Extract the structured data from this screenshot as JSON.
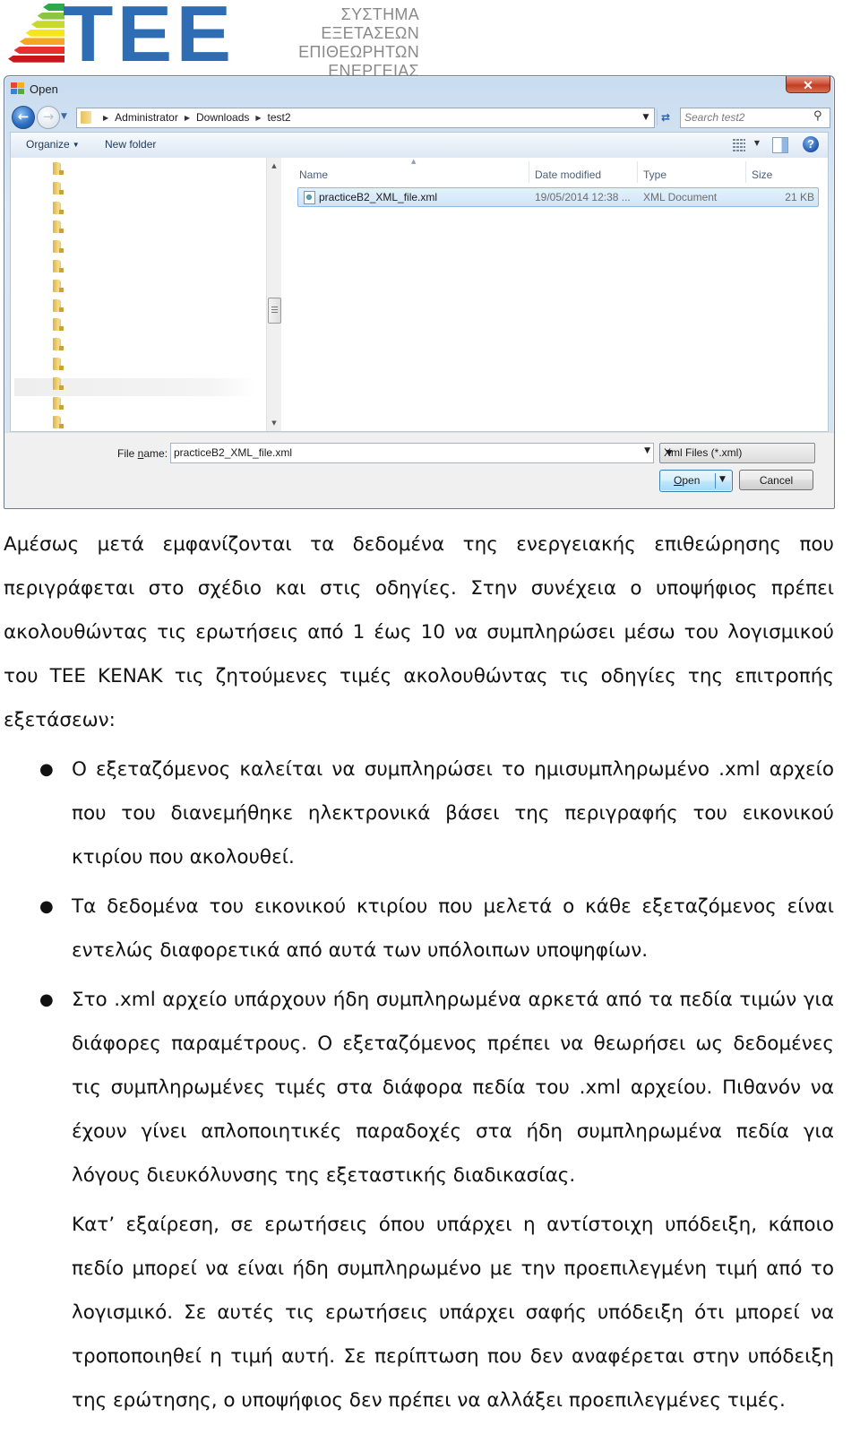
{
  "header": {
    "logo_text": "TEE",
    "system_title_lines": [
      "ΣΥΣΤΗΜΑ ΕΞΕΤΑΣΕΩΝ",
      "ΕΠΙΘΕΩΡΗΤΩΝ",
      "ΕΝΕΡΓΕΙΑΣ"
    ],
    "energy_bar_colors": [
      "#2ea84a",
      "#8cc63f",
      "#c7d92b",
      "#f5e61c",
      "#f5a623",
      "#e8312f",
      "#c8161d"
    ],
    "brand_color": "#2e6db4"
  },
  "dialog": {
    "title": "Open",
    "close_label": "✕",
    "address": {
      "breadcrumbs": [
        "Administrator",
        "Downloads",
        "test2"
      ]
    },
    "search": {
      "placeholder": "Search test2"
    },
    "toolbar": {
      "organize_label": "Organize",
      "new_folder_label": "New folder",
      "help_label": "?"
    },
    "nav_pane": {
      "folder_count": 14,
      "selected_index": 11
    },
    "file_list": {
      "columns": [
        "Name",
        "Date modified",
        "Type",
        "Size"
      ],
      "rows": [
        {
          "name": "practiceB2_XML_file.xml",
          "date_modified": "19/05/2014 12:38 ...",
          "type": "XML Document",
          "size": "21 KB",
          "selected": true
        }
      ]
    },
    "file_name": {
      "label_prefix": "File ",
      "label_access_key": "n",
      "label_suffix": "ame:",
      "value": "practiceB2_XML_file.xml"
    },
    "file_type_filter": {
      "selected": "Xml Files (*.xml)"
    },
    "buttons": {
      "open_access_key": "O",
      "open_rest": "pen",
      "cancel": "Cancel"
    }
  },
  "document": {
    "intro": "Αμέσως μετά εμφανίζονται τα δεδομένα της ενεργειακής επιθεώρησης που περιγράφεται στο σχέδιο και στις οδηγίες. Στην συνέχεια ο υποψήφιος πρέπει ακολουθώντας τις ερωτήσεις από 1 έως 10 να συμπληρώσει μέσω του λογισμικού του ΤΕΕ ΚΕΝΑΚ τις ζητούμενες τιμές ακολουθώντας τις οδηγίες της επιτροπής εξετάσεων:",
    "bullets": [
      "Ο εξεταζόμενος καλείται να συμπληρώσει το ημισυμπληρωμένο .xml αρχείο που του διανεμήθηκε ηλεκτρονικά βάσει της περιγραφής του εικονικού κτιρίου που ακολουθεί.",
      "Τα δεδομένα του εικονικού κτιρίου που μελετά ο κάθε εξεταζόμενος είναι εντελώς διαφορετικά από αυτά των υπόλοιπων υποψηφίων.",
      "Στο .xml αρχείο υπάρχουν ήδη συμπληρωμένα αρκετά από τα πεδία τιμών για διάφορες παραμέτρους. Ο εξεταζόμενος πρέπει να θεωρήσει ως δεδομένες τις συμπληρωμένες τιμές στα διάφορα πεδία του .xml αρχείου. Πιθανόν να έχουν γίνει απλοποιητικές παραδοχές στα ήδη συμπληρωμένα πεδία για λόγους διευκόλυνσης της εξεταστικής διαδικασίας."
    ],
    "bullet_continuation": "Κατ’ εξαίρεση, σε ερωτήσεις όπου υπάρχει η αντίστοιχη υπόδειξη, κάποιο πεδίο μπορεί να είναι ήδη συμπληρωμένο με την προεπιλεγμένη τιμή από το λογισμικό. Σε αυτές τις ερωτήσεις υπάρχει σαφής υπόδειξη ότι μπορεί να τροποποιηθεί η τιμή αυτή. Σε περίπτωση που δεν αναφέρεται στην υπόδειξη της ερώτησης, ο υποψήφιος δεν πρέπει να αλλάξει προεπιλεγμένες τιμές."
  }
}
